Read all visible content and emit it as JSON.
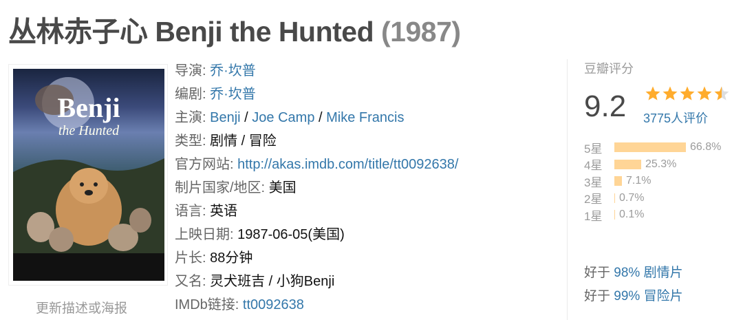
{
  "title": {
    "name": "丛林赤子心 Benji the Hunted",
    "year": "(1987)"
  },
  "poster": {
    "update_link": "更新描述或海报"
  },
  "info": {
    "director_label": "导演:",
    "director": "乔·坎普",
    "writer_label": "编剧:",
    "writer": "乔·坎普",
    "cast_label": "主演:",
    "cast": [
      "Benji",
      "Joe Camp",
      "Mike Francis"
    ],
    "genre_label": "类型:",
    "genre": "剧情 / 冒险",
    "website_label": "官方网站:",
    "website": "http://akas.imdb.com/title/tt0092638/",
    "country_label": "制片国家/地区:",
    "country": "美国",
    "language_label": "语言:",
    "language": "英语",
    "release_label": "上映日期:",
    "release": "1987-06-05(美国)",
    "runtime_label": "片长:",
    "runtime": "88分钟",
    "aka_label": "又名:",
    "aka": "灵犬班吉 / 小狗Benji",
    "imdb_label": "IMDb链接:",
    "imdb": "tt0092638"
  },
  "rating": {
    "header": "豆瓣评分",
    "score": "9.2",
    "stars": 4.5,
    "votes": "3775人评价",
    "star_color": "#ffac2d",
    "bar_color": "#ffd596",
    "breakdown": [
      {
        "label": "5星",
        "pct": "66.8%",
        "value": 66.8
      },
      {
        "label": "4星",
        "pct": "25.3%",
        "value": 25.3
      },
      {
        "label": "3星",
        "pct": "7.1%",
        "value": 7.1
      },
      {
        "label": "2星",
        "pct": "0.7%",
        "value": 0.7
      },
      {
        "label": "1星",
        "pct": "0.1%",
        "value": 0.1
      }
    ],
    "better_than": [
      {
        "prefix": "好于",
        "pct": "98%",
        "genre": "剧情片"
      },
      {
        "prefix": "好于",
        "pct": "99%",
        "genre": "冒险片"
      }
    ]
  }
}
